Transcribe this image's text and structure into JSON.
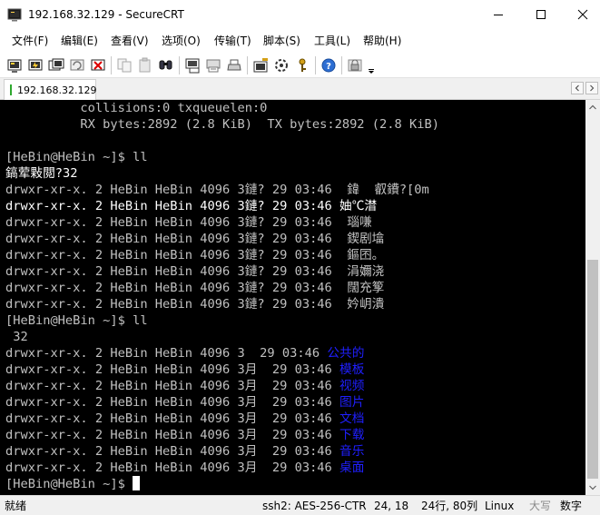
{
  "window": {
    "title": "192.168.32.129 - SecureCRT"
  },
  "menu": {
    "items": [
      "文件(F)",
      "编辑(E)",
      "查看(V)",
      "选项(O)",
      "传输(T)",
      "脚本(S)",
      "工具(L)",
      "帮助(H)"
    ]
  },
  "toolbar": {
    "icons": [
      "connect-icon",
      "quick-connect-icon",
      "connect-in-tab-icon",
      "reconnect-icon",
      "disconnect-icon",
      "copy-icon",
      "paste-icon",
      "find-icon",
      "print-icon",
      "print-screen-icon",
      "print-setup-icon",
      "session-options-icon",
      "global-options-icon",
      "key-map-icon",
      "help-icon",
      "lock-icon"
    ]
  },
  "tab": {
    "label": "192.168.32.129"
  },
  "terminal": {
    "colors": {
      "background": "#000000",
      "text": "#c0c0c0",
      "bright": "#ffffff",
      "blue": "#1f1fff"
    },
    "lines": [
      "          collisions:0 txqueuelen:0",
      "          RX bytes:2892 (2.8 KiB)  TX bytes:2892 (2.8 KiB)",
      "",
      "[HeBin@HeBin ~]$ ll",
      "鎬荤敤閲?32",
      "drwxr-xr-x. 2 HeBin HeBin 4096 3鏈? 29 03:46  鍏  叡鐨?[0m",
      "drwxr-xr-x. 2 HeBin HeBin 4096 3鏈? 29 03:46 妯℃澘",
      "drwxr-xr-x. 2 HeBin HeBin 4096 3鏈? 29 03:46  瑙嗛",
      "drwxr-xr-x. 2 HeBin HeBin 4096 3鏈? 29 03:46  鍥剧墖",
      "drwxr-xr-x. 2 HeBin HeBin 4096 3鏈? 29 03:46  鏂囨。",
      "drwxr-xr-x. 2 HeBin HeBin 4096 3鏈? 29 03:46  涓嬭浇",
      "drwxr-xr-x. 2 HeBin HeBin 4096 3鏈? 29 03:46  闊充箰",
      "drwxr-xr-x. 2 HeBin HeBin 4096 3鏈? 29 03:46  妗岄潰",
      "[HeBin@HeBin ~]$ ll",
      " 32",
      "drwxr-xr-x. 2 HeBin HeBin 4096 3  29 03:46 ",
      "drwxr-xr-x. 2 HeBin HeBin 4096 3月  29 03:46 ",
      "drwxr-xr-x. 2 HeBin HeBin 4096 3月  29 03:46 ",
      "drwxr-xr-x. 2 HeBin HeBin 4096 3月  29 03:46 ",
      "drwxr-xr-x. 2 HeBin HeBin 4096 3月  29 03:46 ",
      "drwxr-xr-x. 2 HeBin HeBin 4096 3月  29 03:46 ",
      "drwxr-xr-x. 2 HeBin HeBin 4096 3月  29 03:46 ",
      "drwxr-xr-x. 2 HeBin HeBin 4096 3月  29 03:46 ",
      "[HeBin@HeBin ~]$ "
    ],
    "blue_names": [
      "",
      "",
      "",
      "",
      "",
      "",
      "",
      "",
      "",
      "",
      "",
      "",
      "",
      "",
      "",
      "公共的",
      "模板",
      "视频",
      "图片",
      "文档",
      "下载",
      "音乐",
      "桌面",
      ""
    ]
  },
  "status": {
    "ready": "就绪",
    "cipher": "ssh2: AES-256-CTR",
    "cursor_pos": "24,  18",
    "size": "24行, 80列",
    "terminal_type": "Linux",
    "caps": "大写",
    "num": "数字"
  }
}
